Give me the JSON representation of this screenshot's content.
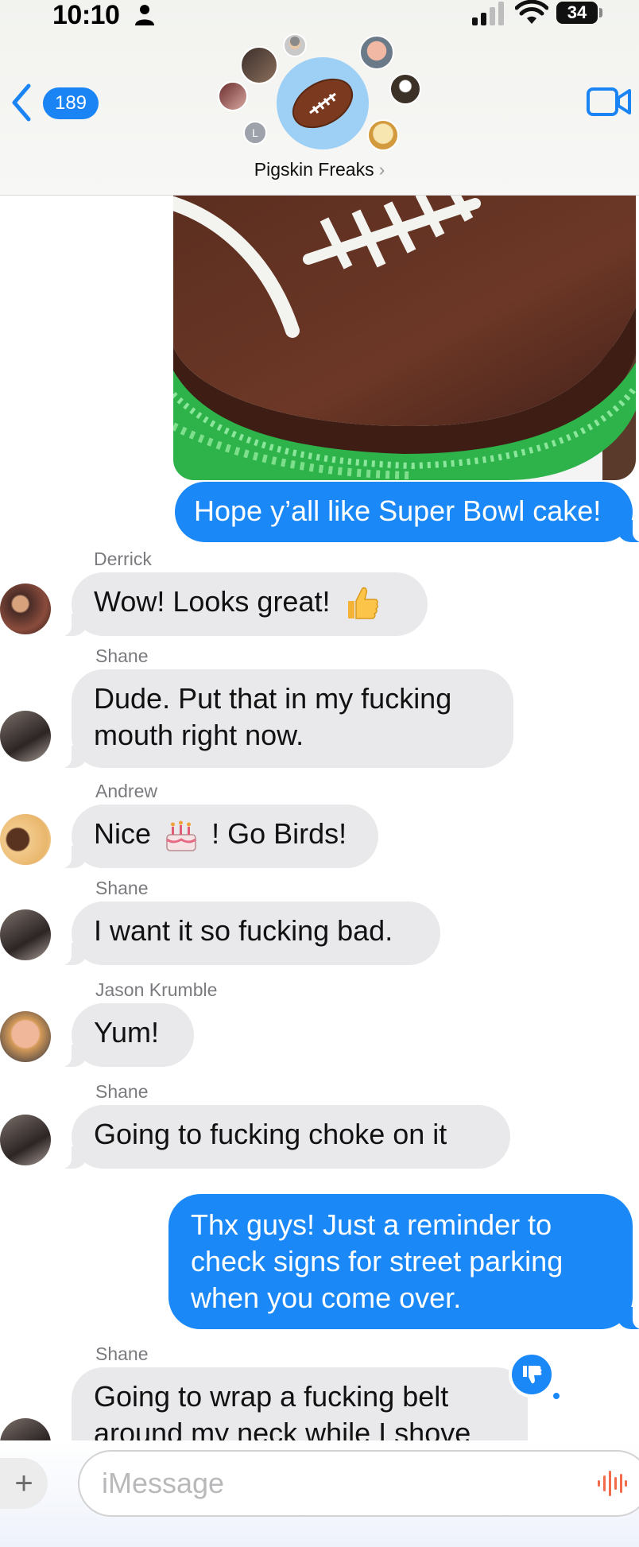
{
  "status_bar": {
    "time": "10:10",
    "battery": "34"
  },
  "header": {
    "unread_count": "189",
    "group_name": "Pigskin Freaks",
    "chevron": "›",
    "participant_initial": "L"
  },
  "colors": {
    "outgoing_bubble": "#1b88f7",
    "incoming_bubble": "#e9e9eb",
    "badge": "#1a84f5",
    "group_avatar_bg": "#9ed0f6"
  },
  "messages": [
    {
      "direction": "out",
      "text": "Hope y’all like Super Bowl cake!"
    },
    {
      "direction": "in",
      "sender": "Derrick",
      "text": "Wow! Looks great!",
      "emoji": "thumbs-up"
    },
    {
      "direction": "in",
      "sender": "Shane",
      "text": "Dude. Put that in my fucking mouth right now."
    },
    {
      "direction": "in",
      "sender": "Andrew",
      "text_before": "Nice",
      "emoji": "birthday-cake",
      "text_after": "! Go Birds!"
    },
    {
      "direction": "in",
      "sender": "Shane",
      "text": "I want it so fucking bad."
    },
    {
      "direction": "in",
      "sender": "Jason Krumble",
      "text": "Yum!"
    },
    {
      "direction": "in",
      "sender": "Shane",
      "text": "Going to fucking choke on it"
    },
    {
      "direction": "out",
      "text": "Thx guys! Just a reminder to check signs for street parking when you come over."
    },
    {
      "direction": "in",
      "sender": "Shane",
      "text": "Going to wrap a fucking belt around my neck while I shove",
      "reaction": "thumbs-down"
    }
  ],
  "composer": {
    "placeholder": "iMessage",
    "plus": "+"
  }
}
